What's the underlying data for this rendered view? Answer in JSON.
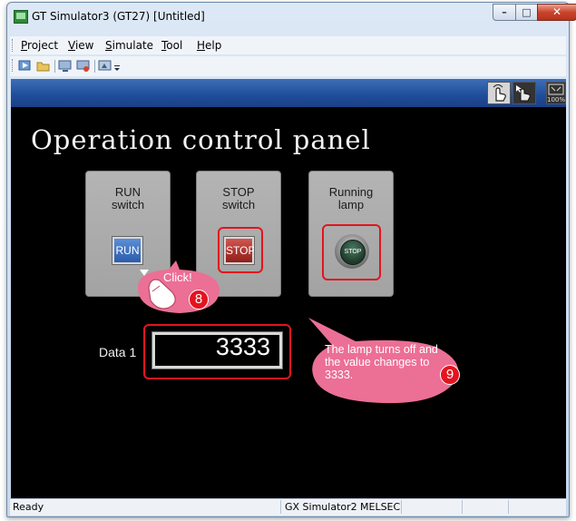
{
  "window": {
    "title": "GT Simulator3 (GT27)  [Untitled]"
  },
  "window_buttons": {
    "minimize": "–",
    "maximize": "□",
    "close": "✕"
  },
  "menu": [
    {
      "label": "Project",
      "mnemonic": "P",
      "rest": "roject"
    },
    {
      "label": "View",
      "mnemonic": "V",
      "rest": "iew"
    },
    {
      "label": "Simulate",
      "mnemonic": "S",
      "rest": "imulate"
    },
    {
      "label": "Tool",
      "mnemonic": "T",
      "rest": "ool"
    },
    {
      "label": "Help",
      "mnemonic": "H",
      "rest": "elp"
    }
  ],
  "toolbar_icons": [
    "start-simulation-icon",
    "open-icon",
    "monitor-icon",
    "device-icon",
    "screen-icon",
    "toolbar-options-icon"
  ],
  "hmi_header_icons": [
    "touch-hand-icon",
    "touch-arrow-icon",
    "zoom-100-icon"
  ],
  "hmi": {
    "title": "Operation control panel",
    "run_group": {
      "label": "RUN\nswitch",
      "button": "RUN"
    },
    "stop_group": {
      "label": "STOP\nswitch",
      "button": "STOP"
    },
    "lamp_group": {
      "label": "Running\nlamp",
      "lamp": "STOP"
    },
    "data_label": "Data 1",
    "data_value": "3333"
  },
  "annotations": {
    "click": {
      "text": "Click!",
      "step": "8"
    },
    "note": {
      "text": "The lamp turns off and the value changes to 3333.",
      "step": "9"
    },
    "highlight_color": "#e3141e",
    "bubble_color": "#ec6f95"
  },
  "status": {
    "ready": "Ready",
    "sim": "GX Simulator2",
    "plc": "MELSEC"
  }
}
